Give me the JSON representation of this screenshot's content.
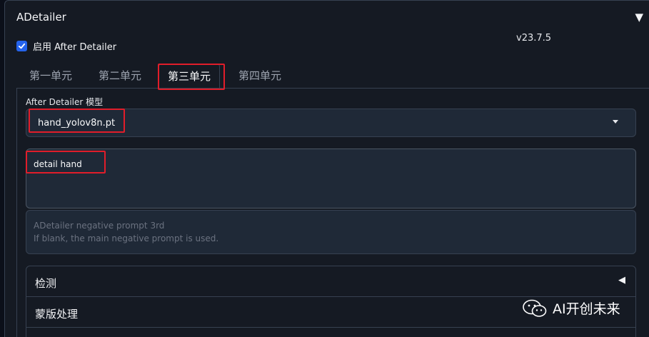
{
  "panel": {
    "title": "ADetailer",
    "version": "v23.7.5"
  },
  "enable": {
    "label": "启用 After Detailer",
    "checked": true
  },
  "tabs": [
    {
      "label": "第一单元",
      "selected": false
    },
    {
      "label": "第二单元",
      "selected": false
    },
    {
      "label": "第三单元",
      "selected": true
    },
    {
      "label": "第四单元",
      "selected": false
    }
  ],
  "model": {
    "label": "After Detailer 模型",
    "value": "hand_yolov8n.pt"
  },
  "prompt": {
    "value": "detail hand"
  },
  "negative_prompt": {
    "placeholder_line1": "ADetailer negative prompt 3rd",
    "placeholder_line2": "If blank, the main negative prompt is used."
  },
  "accordions": [
    {
      "label": "检测"
    },
    {
      "label": "蒙版处理"
    }
  ],
  "watermark": {
    "text": "AI开创未来"
  },
  "colors": {
    "accent": "#2563eb",
    "highlight": "#e11d2a",
    "background": "#151a23"
  }
}
